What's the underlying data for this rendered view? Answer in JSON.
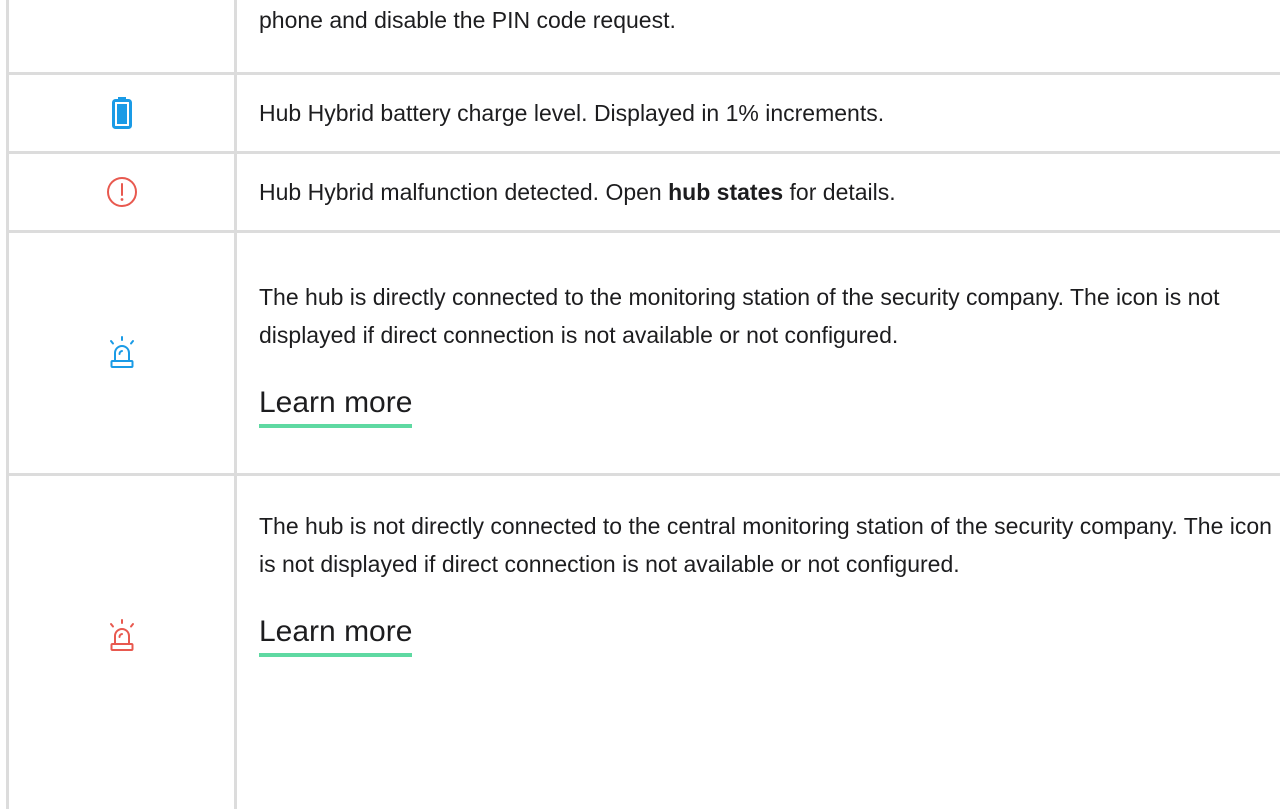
{
  "rows": [
    {
      "icon": "none",
      "text": "phone and disable the PIN code request."
    },
    {
      "icon": "battery-icon",
      "icon_color": "#1a9be6",
      "text": "Hub Hybrid battery charge level. Displayed in 1% increments."
    },
    {
      "icon": "alert-circle-icon",
      "icon_color": "#e8594f",
      "text_before": "Hub Hybrid malfunction detected. Open ",
      "text_bold": "hub states",
      "text_after": " for details."
    },
    {
      "icon": "siren-icon",
      "icon_color": "#1a9be6",
      "text": "The hub is directly connected to the monitoring station of the security company. The icon is not displayed if direct connection is not available or not configured.",
      "link": "Learn more"
    },
    {
      "icon": "siren-icon",
      "icon_color": "#e8594f",
      "text": "The hub is not directly connected to the central monitoring station of the security company. The icon is not displayed if direct connection is not available or not configured.",
      "link": "Learn more"
    }
  ],
  "colors": {
    "border": "#dcdcdc",
    "link_underline": "#5fd9a2",
    "text": "#1d1d1f"
  }
}
